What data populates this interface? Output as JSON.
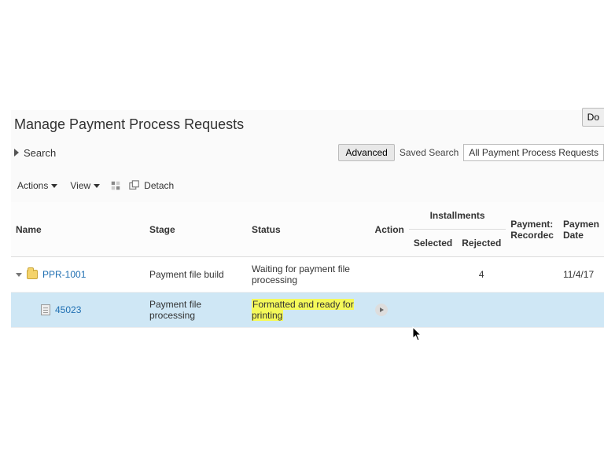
{
  "title": "Manage Payment Process Requests",
  "corner_button": "Do",
  "search": {
    "label": "Search",
    "advanced_btn": "Advanced",
    "saved_label": "Saved Search",
    "saved_value": "All Payment Process Requests"
  },
  "toolbar": {
    "actions": "Actions",
    "view": "View",
    "detach": "Detach"
  },
  "columns": {
    "name": "Name",
    "stage": "Stage",
    "status": "Status",
    "action": "Action",
    "installments": "Installments",
    "inst_selected": "Selected",
    "inst_rejected": "Rejected",
    "pay_recorded": "Payment: Recordec",
    "pay_date": "Paymen Date"
  },
  "rows": [
    {
      "name": "PPR-1001",
      "stage": "Payment file build",
      "status": "Waiting for payment file processing",
      "rejected": "4",
      "pay_date": "11/4/17"
    },
    {
      "name": "45023",
      "stage": "Payment file processing",
      "status": "Formatted and ready for printing"
    }
  ]
}
